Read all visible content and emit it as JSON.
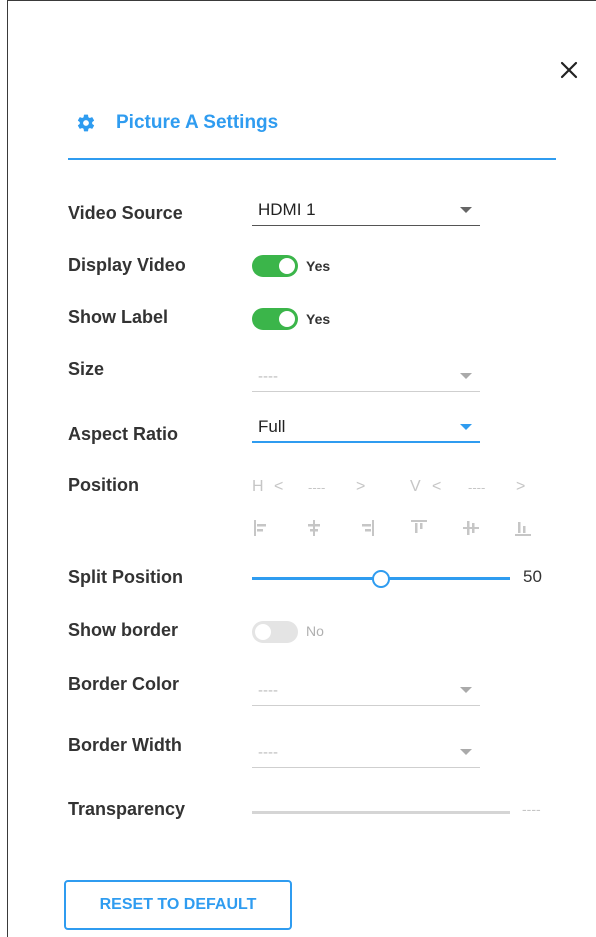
{
  "header": {
    "title": "Picture A Settings",
    "icon": "gear-icon",
    "accent_color": "#2f9cf0"
  },
  "close": {
    "icon": "close-icon"
  },
  "fields": {
    "video_source": {
      "label": "Video Source",
      "value": "HDMI 1"
    },
    "display_video": {
      "label": "Display Video",
      "state_text": "Yes",
      "on": true
    },
    "show_label": {
      "label": "Show Label",
      "state_text": "Yes",
      "on": true
    },
    "size": {
      "label": "Size",
      "value": "----"
    },
    "aspect_ratio": {
      "label": "Aspect Ratio",
      "value": "Full"
    },
    "position": {
      "label": "Position",
      "h_label": "H",
      "h_value": "----",
      "v_label": "V",
      "v_value": "----",
      "prev_glyph": "<",
      "next_glyph": ">",
      "align_icons": [
        "align-left-icon",
        "align-center-horizontal-icon",
        "align-right-icon",
        "align-top-icon",
        "align-center-vertical-icon",
        "align-bottom-icon"
      ]
    },
    "split_position": {
      "label": "Split Position",
      "value": "50"
    },
    "show_border": {
      "label": "Show border",
      "state_text": "No",
      "on": false
    },
    "border_color": {
      "label": "Border Color",
      "value": "----"
    },
    "border_width": {
      "label": "Border Width",
      "value": "----"
    },
    "transparency": {
      "label": "Transparency",
      "value": "----"
    }
  },
  "actions": {
    "reset_label": "RESET TO DEFAULT"
  },
  "colors": {
    "toggle_on": "#3bb54a",
    "accent": "#2f9cf0"
  }
}
